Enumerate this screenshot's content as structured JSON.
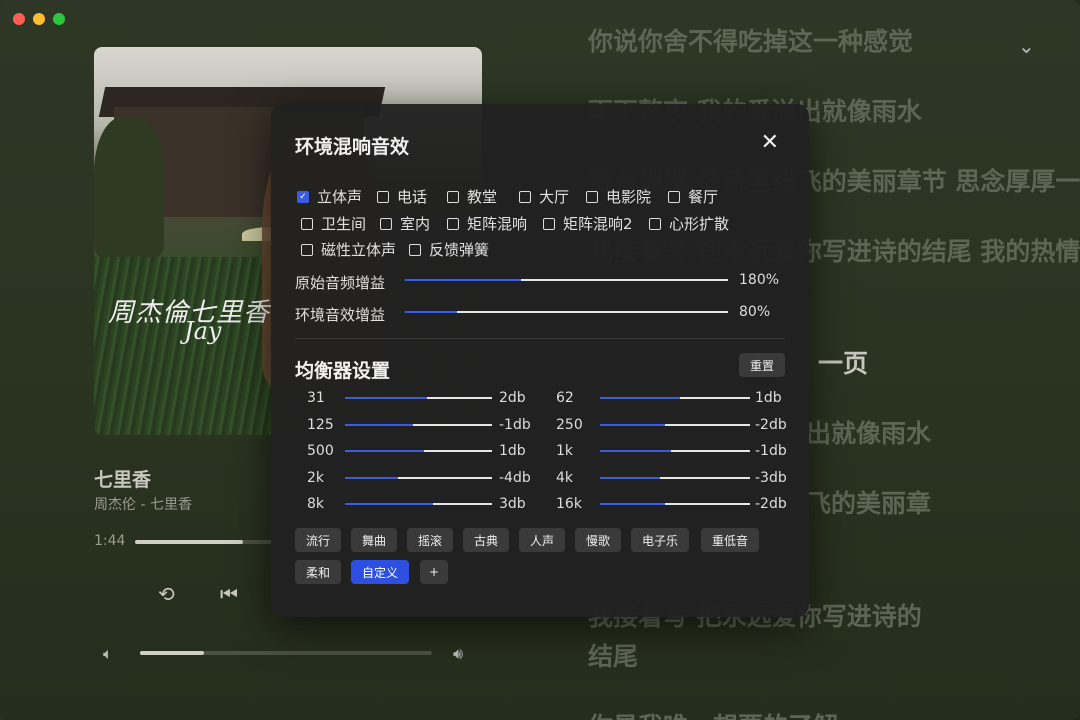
{
  "lyrics": [
    {
      "text": "你说你舍不得吃掉这一种感觉",
      "active": false
    },
    {
      "text": "雨下整夜 我的爱溢出就像雨水",
      "active": false
    },
    {
      "text": "窗台蝴蝶 像诗里纷飞的美丽章节 思念厚厚一叠",
      "active": false
    },
    {
      "text": "我接着写 把永远爱你写进诗的结尾 我的热情冷",
      "active": false
    },
    {
      "text": "",
      "active": false
    },
    {
      "text": "一页",
      "active": true
    },
    {
      "text": "出就像雨水",
      "active": false
    },
    {
      "text": "飞的美丽章",
      "active": false
    },
    {
      "text": "",
      "active": false
    },
    {
      "text": "我接着写 把永远爱你写进诗的",
      "active": false
    },
    {
      "text": "结尾",
      "active": false
    },
    {
      "text": "你是我唯一想要的了解",
      "active": false
    }
  ],
  "player": {
    "title": "七里香",
    "subtitle": "周杰伦 - 七里香",
    "time": "1:44",
    "progress": 0.4,
    "volume": 0.22,
    "cover_text": "周杰倫七里香",
    "cover_text2": "Jay"
  },
  "modal": {
    "title": "环境混响音效",
    "close": "✕",
    "options": [
      {
        "label": "立体声",
        "checked": true
      },
      {
        "label": "电话",
        "checked": false
      },
      {
        "label": "教堂",
        "checked": false
      },
      {
        "label": "大厅",
        "checked": false
      },
      {
        "label": "电影院",
        "checked": false
      },
      {
        "label": "餐厅",
        "checked": false
      },
      {
        "label": "卫生间",
        "checked": false
      },
      {
        "label": "室内",
        "checked": false
      },
      {
        "label": "矩阵混响",
        "checked": false
      },
      {
        "label": "矩阵混响2",
        "checked": false
      },
      {
        "label": "心形扩散",
        "checked": false
      },
      {
        "label": "磁性立体声",
        "checked": false
      },
      {
        "label": "反馈弹簧",
        "checked": false
      }
    ],
    "gain_original": {
      "label": "原始音频增益",
      "value": "180%",
      "fraction": 0.36
    },
    "gain_ambient": {
      "label": "环境音效增益",
      "value": "80%",
      "fraction": 0.16
    },
    "eq_title": "均衡器设置",
    "reset": "重置",
    "bands": [
      {
        "freq": "31",
        "value": "2db",
        "fraction": 0.56
      },
      {
        "freq": "62",
        "value": "1db",
        "fraction": 0.53
      },
      {
        "freq": "125",
        "value": "-1db",
        "fraction": 0.46
      },
      {
        "freq": "250",
        "value": "-2db",
        "fraction": 0.43
      },
      {
        "freq": "500",
        "value": "1db",
        "fraction": 0.54
      },
      {
        "freq": "1k",
        "value": "-1db",
        "fraction": 0.47
      },
      {
        "freq": "2k",
        "value": "-4db",
        "fraction": 0.36
      },
      {
        "freq": "4k",
        "value": "-3db",
        "fraction": 0.4
      },
      {
        "freq": "8k",
        "value": "3db",
        "fraction": 0.6
      },
      {
        "freq": "16k",
        "value": "-2db",
        "fraction": 0.43
      }
    ],
    "presets": [
      {
        "label": "流行",
        "active": false
      },
      {
        "label": "舞曲",
        "active": false
      },
      {
        "label": "摇滚",
        "active": false
      },
      {
        "label": "古典",
        "active": false
      },
      {
        "label": "人声",
        "active": false
      },
      {
        "label": "慢歌",
        "active": false
      },
      {
        "label": "电子乐",
        "active": false
      },
      {
        "label": "重低音",
        "active": false
      },
      {
        "label": "柔和",
        "active": false
      },
      {
        "label": "自定义",
        "active": true
      },
      {
        "label": "+",
        "active": false
      }
    ]
  }
}
